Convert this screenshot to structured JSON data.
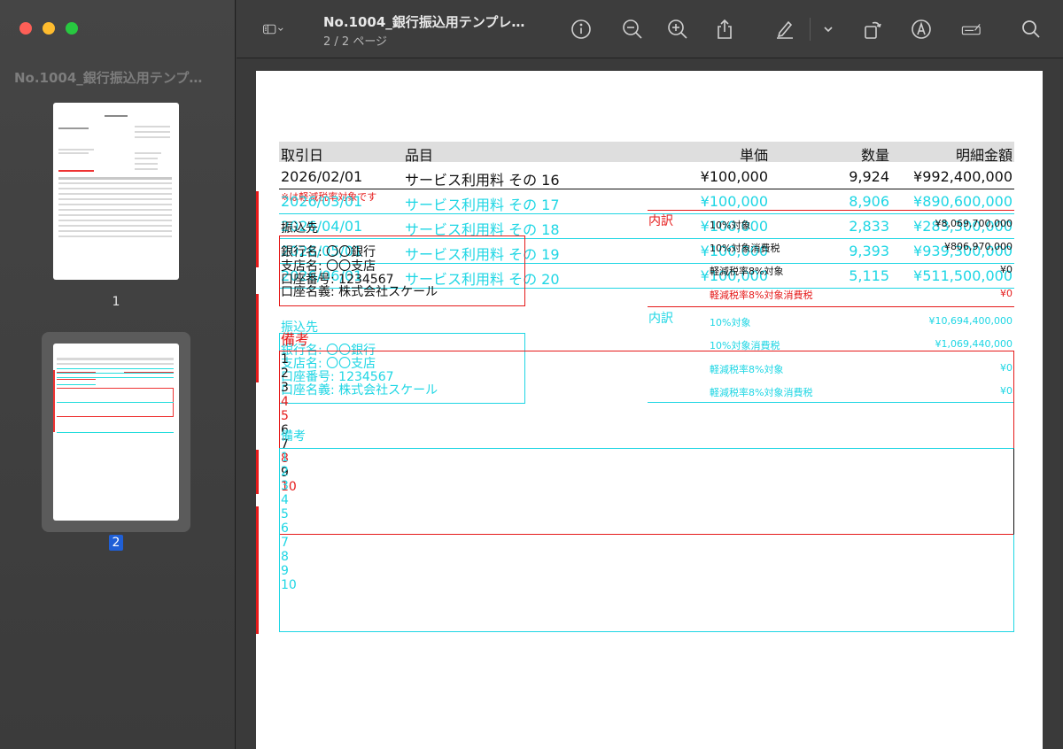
{
  "window": {
    "sidebar_title": "No.1004_銀行振込用テンプ…",
    "doc_title": "No.1004_銀行振込用テンプレ…",
    "doc_page_indicator": "2 / 2 ページ"
  },
  "thumbnails": [
    {
      "label": "1"
    },
    {
      "label": "2"
    }
  ],
  "table": {
    "headers": [
      "取引日",
      "品目",
      "単価",
      "数量",
      "明細金額"
    ],
    "rows_black": [
      {
        "date": "2026/02/01",
        "item": "サービス利用料 その 16",
        "price": "¥100,000",
        "qty": "9,924",
        "amount": "¥992,400,000"
      }
    ],
    "rows_cyan": [
      {
        "date": "2026/03/01",
        "item": "サービス利用料 その 17",
        "price": "¥100,000",
        "qty": "8,906",
        "amount": "¥890,600,000"
      },
      {
        "date": "2026/04/01",
        "item": "サービス利用料 その 18",
        "price": "¥100,000",
        "qty": "2,833",
        "amount": "¥283,300,000"
      },
      {
        "date": "2026/05/01",
        "item": "サービス利用料 その 19",
        "price": "¥100,000",
        "qty": "9,393",
        "amount": "¥939,300,000"
      },
      {
        "date": "2026/06/01",
        "item": "サービス利用料 その 20",
        "price": "¥100,000",
        "qty": "5,115",
        "amount": "¥511,500,000"
      }
    ]
  },
  "note_reduced": "※は軽減税率対象です",
  "breakdown_black": {
    "label": "内訳",
    "rows": [
      {
        "name": "10%対象",
        "value": "¥8,069,700,000"
      },
      {
        "name": "10%対象消費税",
        "value": "¥806,970,000"
      },
      {
        "name": "軽減税率8%対象",
        "value": "¥0"
      },
      {
        "name": "軽減税率8%対象消費税",
        "value": "¥0"
      }
    ]
  },
  "breakdown_cyan": {
    "label": "内訳",
    "rows": [
      {
        "name": "10%対象",
        "value": "¥10,694,400,000"
      },
      {
        "name": "10%対象消費税",
        "value": "¥1,069,440,000"
      },
      {
        "name": "軽減税率8%対象",
        "value": "¥0"
      },
      {
        "name": "軽減税率8%対象消費税",
        "value": "¥0"
      }
    ]
  },
  "bank_black": {
    "title": "振込先",
    "lines": [
      "銀行名: 〇〇銀行",
      "支店名: 〇〇支店",
      "口座番号: 1234567",
      "口座名義: 株式会社スケール"
    ]
  },
  "bank_cyan": {
    "title": "振込先",
    "lines": [
      "銀行名: 〇〇銀行",
      "支店名: 〇〇支店",
      "口座番号: 1234567",
      "口座名義: 株式会社スケール"
    ]
  },
  "remarks_red": {
    "title": "備考",
    "lines": [
      "1",
      "2",
      "3",
      "4",
      "5",
      "6",
      "7",
      "8",
      "9",
      "10"
    ]
  },
  "remarks_cyan": {
    "title": "備考",
    "lines": [
      "1",
      "2",
      "3",
      "4",
      "5",
      "6",
      "7",
      "8",
      "9",
      "10"
    ]
  },
  "colors": {
    "cyan": "#1ed6e4",
    "red": "#e51a1a",
    "page_indicator_selected": "#1f5fd6"
  }
}
